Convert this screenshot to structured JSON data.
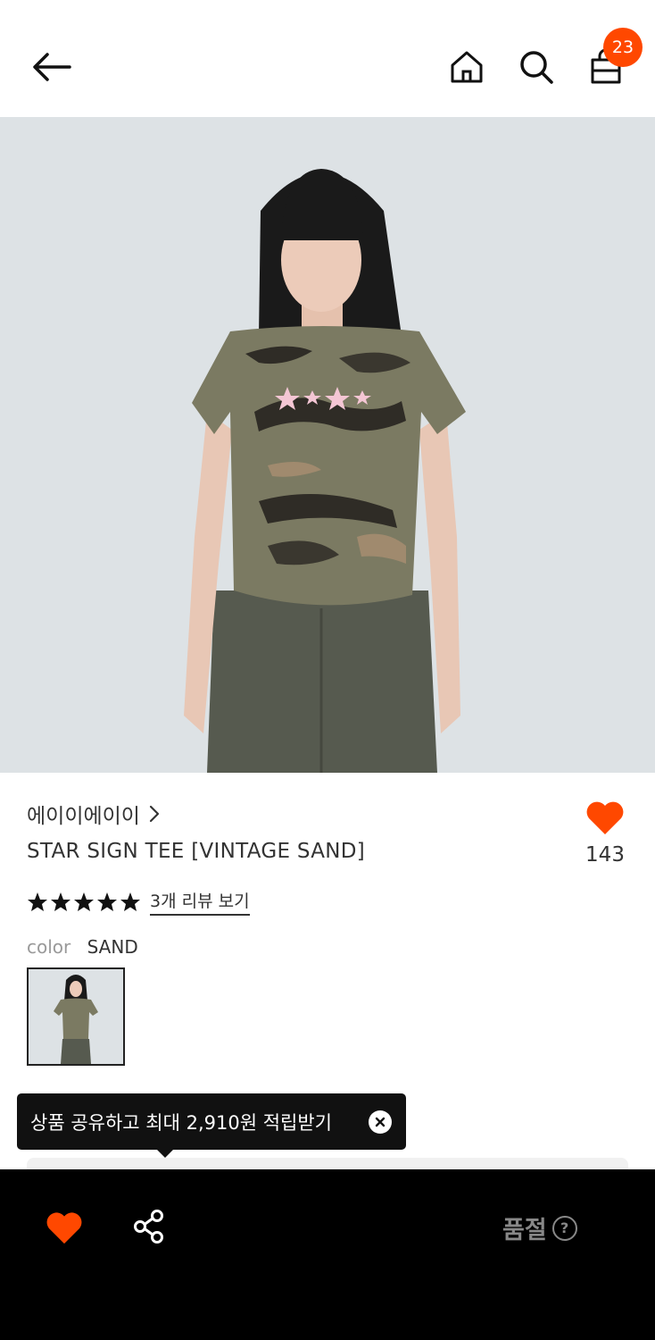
{
  "header": {
    "cart_count": "23",
    "badge_color": "#ff4800"
  },
  "product": {
    "image_icon": "product-photo",
    "brand": "에이이에이이",
    "title": "STAR SIGN TEE [VINTAGE SAND]",
    "like_count": "143",
    "rating_stars": 5,
    "review_link": "3개 리뷰 보기",
    "color_label": "color",
    "color_value": "SAND"
  },
  "tooltip": {
    "text": "상품 공유하고 최대 2,910원 적립받기"
  },
  "bottom_bar": {
    "status": "품절",
    "help_glyph": "?"
  },
  "colors": {
    "accent": "#ff4800",
    "bottom_bar": "#000000",
    "photo_bg": "#dde2e5"
  }
}
